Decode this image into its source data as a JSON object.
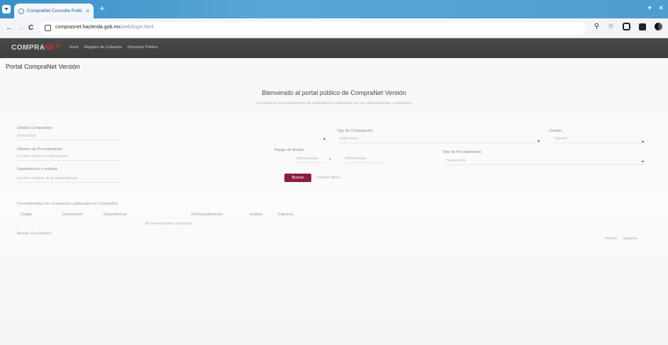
{
  "browser": {
    "tab_title": "CompraNet Consulta Publi...",
    "tab_close": "×",
    "new_tab": "+",
    "window_controls": [
      "▾",
      "✕"
    ],
    "url_host": "comprasnet.hacienda.gob.mx",
    "url_path": "/web/login.html",
    "nav_back": "←",
    "nav_forward": "→",
    "nav_reload": "C",
    "zoom_icon": "⚲",
    "star_icon": "☆"
  },
  "site": {
    "logo_main": "COMPRA",
    "logo_accent": "NET",
    "nav": [
      "Inicio",
      "Registro de Licitantes",
      "Directorio Público"
    ]
  },
  "breadcrumb": "Portal CompraNet Versión",
  "heading": "Bienvenido al portal público de CompraNet Versión",
  "subheading": "Consulta los procedimientos de contratación publicados por las dependencias y entidades",
  "filters": {
    "unidad_label": "Unidad Compradora",
    "unidad_value": "Selecciona",
    "tipo_label": "Tipo de Contratación",
    "tipo_value": "Selecciona",
    "estado_label": "Estado",
    "estado_value": "Vigente",
    "numero_label": "Número de Procedimiento",
    "numero_value": "Escribe número o descripción",
    "fecha_label": "Rango de fechas",
    "fecha_from": "dd/mm/aaaa",
    "fecha_sep": "a",
    "fecha_to": "dd/mm/aaaa",
    "tipo_proc_label": "Tipo de Procedimiento",
    "tipo_proc_value": "Selecciona",
    "dependencia_label": "Dependencia o entidad",
    "dependencia_value": "Escribe nombre de la dependencia"
  },
  "buttons": {
    "search": "Buscar",
    "clear": "Limpiar filtros"
  },
  "results": {
    "title": "Procedimientos de contratación publicados en CompraNet",
    "columns": [
      "Código",
      "Descripción",
      "Dependencia",
      "Fecha publicación",
      "Estatus",
      "Vigencia"
    ],
    "empty": "No se encontraron resultados",
    "per_page_label": "Mostrar",
    "per_page_value": "10",
    "per_page_suffix": "registros",
    "pager_prev": "Anterior",
    "pager_next": "Siguiente"
  }
}
